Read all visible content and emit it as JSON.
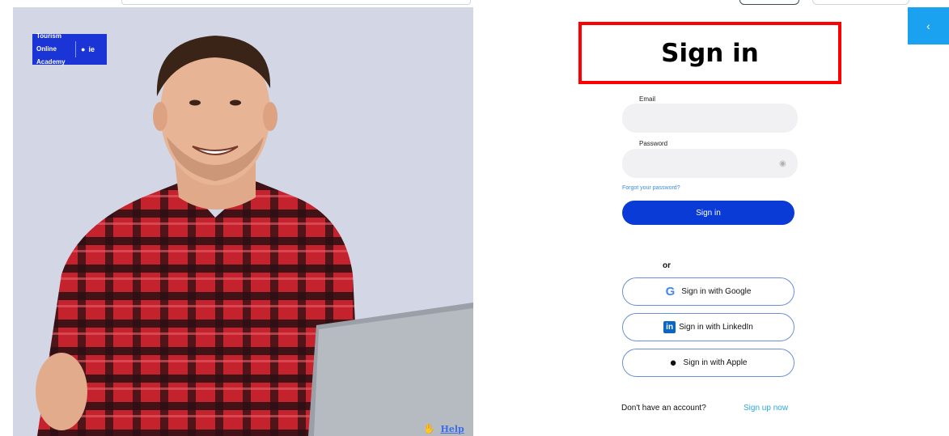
{
  "brand": {
    "line1": "Tourism",
    "line2": "Online",
    "line3": "Academy",
    "ie": "ie"
  },
  "help": {
    "label": "Help >"
  },
  "form": {
    "heading": "Sign in",
    "email_label": "Email",
    "email_value": "",
    "password_label": "Password",
    "password_value": "",
    "forgot_label": "Forgot your password?",
    "submit_label": "Sign in",
    "or_label": "or"
  },
  "social": [
    {
      "label": "Sign in with Google",
      "icon": "google-icon"
    },
    {
      "label": "Sign in with LinkedIn",
      "icon": "linkedin-icon"
    },
    {
      "label": "Sign in with Apple",
      "icon": "apple-icon"
    }
  ],
  "footer": {
    "prompt": "Don't have an account?",
    "signup_label": "Sign up now"
  },
  "colors": {
    "primary": "#0a3bd6",
    "highlight": "#ff0000",
    "side_tab": "#1aa1ef",
    "brand": "#1b34d6",
    "link": "#3b8ce0"
  }
}
